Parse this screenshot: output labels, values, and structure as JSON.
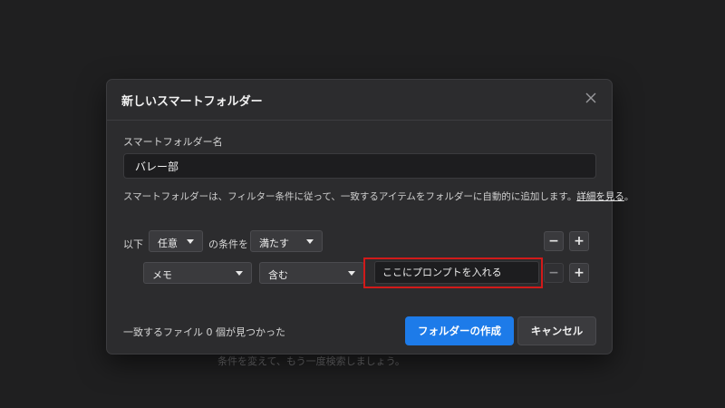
{
  "background_hint": "条件を変えて、もう一度検索しましょう。",
  "dialog": {
    "title": "新しいスマートフォルダー",
    "name_label": "スマートフォルダー名",
    "name_value": "バレー部",
    "description": "スマートフォルダーは、フィルター条件に従って、一致するアイテムをフォルダーに自動的に追加します。",
    "details_link": "詳細を見る",
    "details_suffix": "。"
  },
  "criteria": {
    "prefix": "以下",
    "match_mode": "任意",
    "middle": "の条件を",
    "match_action": "満たす",
    "rule": {
      "field": "メモ",
      "operator": "含む",
      "value_placeholder": "ここにプロンプトを入れる"
    },
    "minus_label": "−",
    "plus_label": "+"
  },
  "footer": {
    "found_text": "一致するファイル 0 個が見つかった",
    "create_label": "フォルダーの作成",
    "cancel_label": "キャンセル"
  },
  "colors": {
    "primary": "#1d7be9",
    "highlight": "#d11a1a",
    "background": "#1f1f20",
    "dialog": "#2c2c2e"
  },
  "icons": {
    "close": "close-icon",
    "dropdown": "chevron-down-icon"
  }
}
